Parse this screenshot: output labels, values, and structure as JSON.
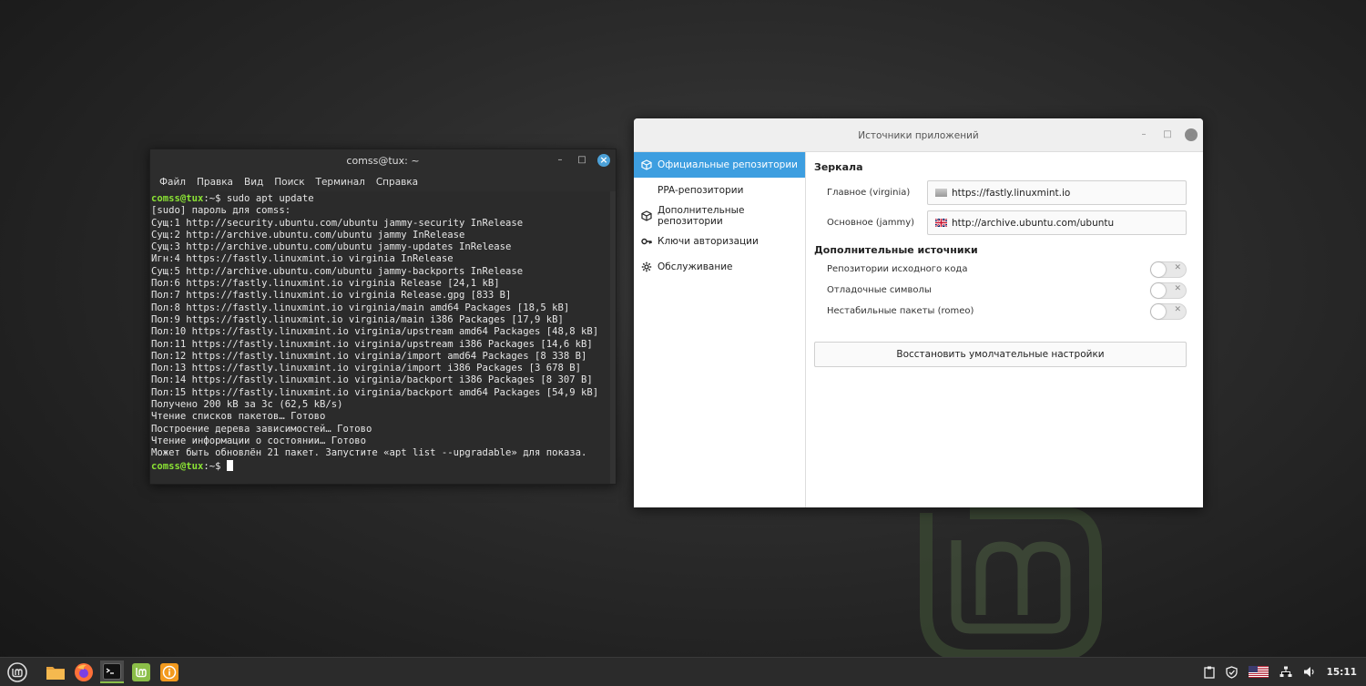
{
  "terminal": {
    "title": "comss@tux: ~",
    "menu": [
      "Файл",
      "Правка",
      "Вид",
      "Поиск",
      "Терминал",
      "Справка"
    ],
    "prompt_user": "comss@tux",
    "prompt_suffix": ":~$",
    "command": " sudo apt update",
    "output": [
      "[sudo] пароль для comss:",
      "Сущ:1 http://security.ubuntu.com/ubuntu jammy-security InRelease",
      "Сущ:2 http://archive.ubuntu.com/ubuntu jammy InRelease",
      "Сущ:3 http://archive.ubuntu.com/ubuntu jammy-updates InRelease",
      "Игн:4 https://fastly.linuxmint.io virginia InRelease",
      "Сущ:5 http://archive.ubuntu.com/ubuntu jammy-backports InRelease",
      "Пол:6 https://fastly.linuxmint.io virginia Release [24,1 kB]",
      "Пол:7 https://fastly.linuxmint.io virginia Release.gpg [833 B]",
      "Пол:8 https://fastly.linuxmint.io virginia/main amd64 Packages [18,5 kB]",
      "Пол:9 https://fastly.linuxmint.io virginia/main i386 Packages [17,9 kB]",
      "Пол:10 https://fastly.linuxmint.io virginia/upstream amd64 Packages [48,8 kB]",
      "Пол:11 https://fastly.linuxmint.io virginia/upstream i386 Packages [14,6 kB]",
      "Пол:12 https://fastly.linuxmint.io virginia/import amd64 Packages [8 338 B]",
      "Пол:13 https://fastly.linuxmint.io virginia/import i386 Packages [3 678 B]",
      "Пол:14 https://fastly.linuxmint.io virginia/backport i386 Packages [8 307 B]",
      "Пол:15 https://fastly.linuxmint.io virginia/backport amd64 Packages [54,9 kB]",
      "Получено 200 kB за 3с (62,5 kB/s)",
      "Чтение списков пакетов… Готово",
      "Построение дерева зависимостей… Готово",
      "Чтение информации о состоянии… Готово",
      "Может быть обновлён 21 пакет. Запустите «apt list --upgradable» для показа."
    ]
  },
  "sources": {
    "title": "Источники приложений",
    "sidebar": [
      {
        "label": "Официальные репозитории",
        "icon": "package-icon",
        "active": true
      },
      {
        "label": "PPA-репозитории",
        "icon": "",
        "active": false
      },
      {
        "label": "Дополнительные репозитории",
        "icon": "package-icon",
        "active": false
      },
      {
        "label": "Ключи авторизации",
        "icon": "key-icon",
        "active": false
      },
      {
        "label": "Обслуживание",
        "icon": "gear-icon",
        "active": false
      }
    ],
    "mirrors_title": "Зеркала",
    "mirrors": [
      {
        "label": "Главное (virginia)",
        "value": "https://fastly.linuxmint.io",
        "flag": "gray"
      },
      {
        "label": "Основное (jammy)",
        "value": "http://archive.ubuntu.com/ubuntu",
        "flag": "uk"
      }
    ],
    "extra_title": "Дополнительные источники",
    "toggles": [
      {
        "label": "Репозитории исходного кода",
        "on": false
      },
      {
        "label": "Отладочные символы",
        "on": false
      },
      {
        "label": "Нестабильные пакеты (romeo)",
        "on": false
      }
    ],
    "reset_label": "Восстановить умолчательные настройки"
  },
  "panel": {
    "apps": [
      "menu-icon",
      "files-icon",
      "firefox-icon",
      "terminal-icon",
      "mintupdate-icon",
      "info-icon"
    ],
    "clock": "15:11"
  },
  "colors": {
    "accent": "#3d9ee0",
    "mint_green": "#8bbe48",
    "prompt_green": "#8ae234"
  }
}
